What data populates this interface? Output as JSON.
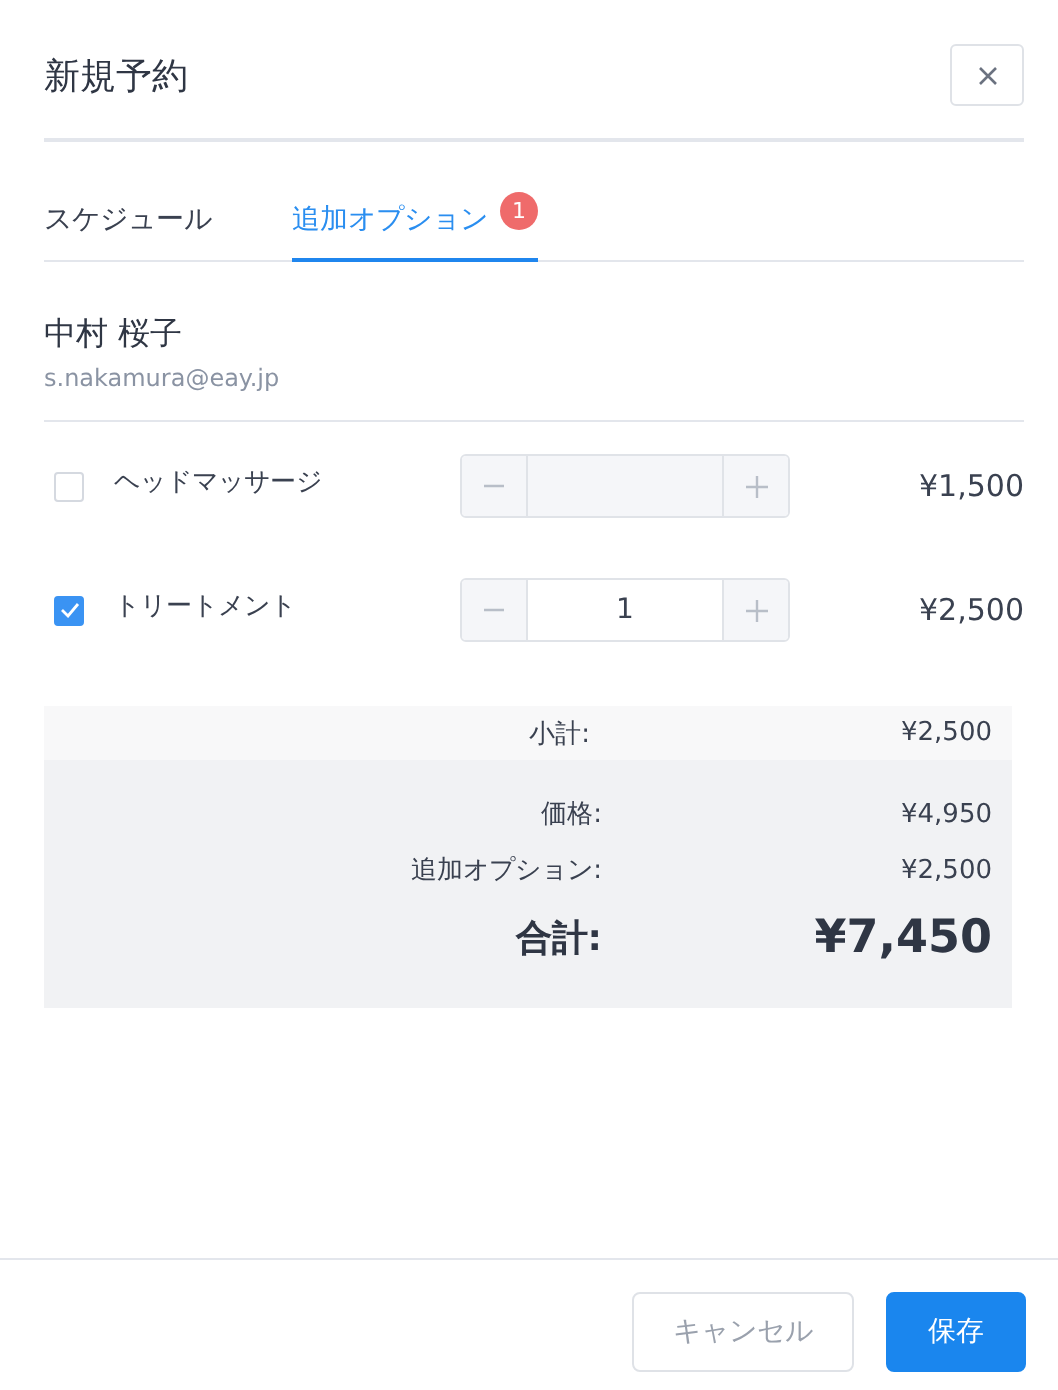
{
  "dialog": {
    "title": "新規予約"
  },
  "tabs": [
    {
      "label": "スケジュール",
      "selected": false
    },
    {
      "label": "追加オプション",
      "selected": true,
      "badge": "1"
    }
  ],
  "customer": {
    "name": "中村 桜子",
    "email": "s.nakamura@eay.jp"
  },
  "options": [
    {
      "name": "ヘッドマッサージ",
      "checked": false,
      "price": "¥1,500"
    },
    {
      "name": "トリートメント",
      "checked": true,
      "quantity": "1",
      "price": "¥2,500"
    }
  ],
  "summary": {
    "subtotal": {
      "label": "小計:",
      "value": "¥2,500"
    },
    "lines": [
      {
        "label": "価格:",
        "value": "¥4,950"
      },
      {
        "label": "追加オプション:",
        "value": "¥2,500"
      }
    ],
    "total": {
      "label": "合計:",
      "value": "¥7,450"
    }
  },
  "buttons": [
    {
      "label": "キャンセル",
      "kind": "secondary"
    },
    {
      "label": "保存",
      "kind": "primary"
    }
  ]
}
